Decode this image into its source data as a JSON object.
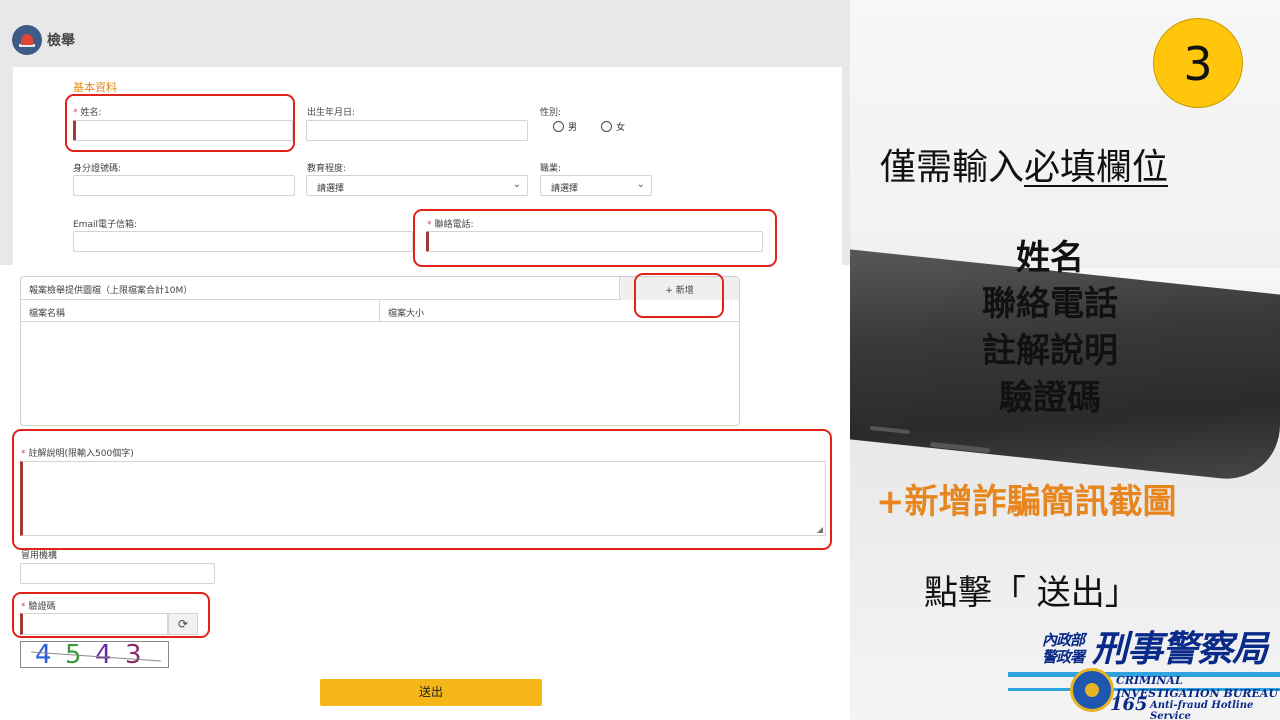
{
  "header": {
    "title": "檢舉"
  },
  "basic": {
    "section_title": "基本資料",
    "name_label": "姓名:",
    "birth_label": "出生年月日:",
    "gender_label": "性別:",
    "gender_male": "男",
    "gender_female": "女",
    "id_label": "身分證號碼:",
    "education_label": "教育程度:",
    "education_value": "請選擇",
    "job_label": "職業:",
    "job_value": "請選擇",
    "email_label": "Email電子信箱:",
    "phone_label": "聯絡電話:"
  },
  "files": {
    "header_label": "報案檢舉提供圖檔（上限檔案合計10M）",
    "add_button": "+ 新增",
    "col_name": "檔案名稱",
    "col_size": "檔案大小"
  },
  "note": {
    "label": "註解說明(限輸入500個字)"
  },
  "agency": {
    "label": "冒用機構"
  },
  "captcha": {
    "label": "驗證碼",
    "digits": [
      "4",
      "5",
      "4",
      "3"
    ],
    "colors": [
      "#2a5fd8",
      "#3a9a3a",
      "#6a2aa8",
      "#8a2a6a"
    ]
  },
  "submit": {
    "label": "送出"
  },
  "right": {
    "step": "3",
    "only_prefix": "僅需輸入",
    "only_underlined": "必填欄位",
    "fields": [
      "姓名",
      "聯絡電話",
      "註解說明",
      "驗證碼"
    ],
    "add_screenshot": "+新增詐騙簡訊截圖",
    "click_submit": "點擊「 送出」"
  },
  "logo": {
    "ministry": "內政部",
    "police": "警政署",
    "bureau": "刑事警察局",
    "english": "CRIMINAL INVESTIGATION BUREAU",
    "hotline_number": "165",
    "hotline_text": "Anti-fraud Hotline Service"
  },
  "colors": {
    "accent_orange": "#e08c1a",
    "highlight_red": "#e2231a",
    "submit_yellow": "#f4b619",
    "badge_yellow": "#ffc60b"
  }
}
